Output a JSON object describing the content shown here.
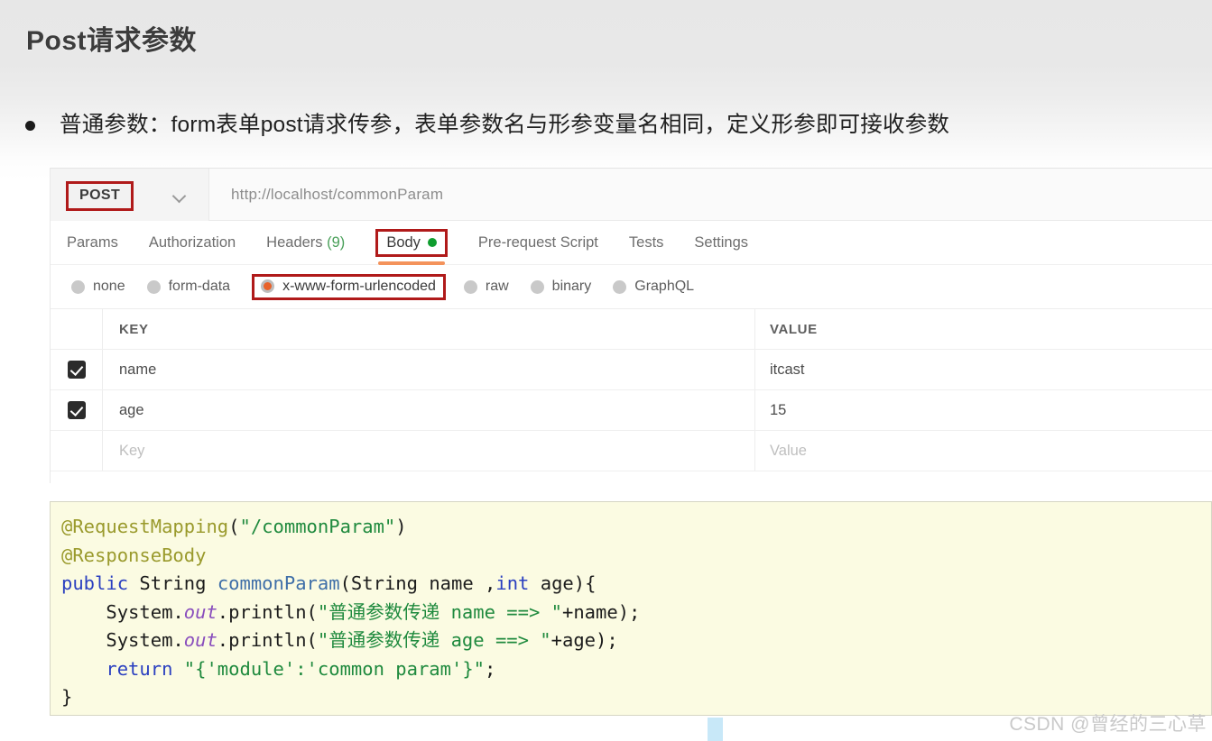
{
  "slide": {
    "title": "Post请求参数",
    "bullet": "普通参数：form表单post请求传参，表单参数名与形参变量名相同，定义形参即可接收参数"
  },
  "postman": {
    "method": "POST",
    "method_caret": "chevron-down-icon",
    "url": "http://localhost/commonParam",
    "tabs": [
      {
        "label": "Params",
        "active": false
      },
      {
        "label": "Authorization",
        "active": false
      },
      {
        "label": "Headers",
        "count": "(9)",
        "active": false
      },
      {
        "label": "Body",
        "active": true,
        "dot": true
      },
      {
        "label": "Pre-request Script",
        "active": false
      },
      {
        "label": "Tests",
        "active": false
      },
      {
        "label": "Settings",
        "active": false
      }
    ],
    "body_types": [
      {
        "label": "none",
        "selected": false
      },
      {
        "label": "form-data",
        "selected": false
      },
      {
        "label": "x-www-form-urlencoded",
        "selected": true
      },
      {
        "label": "raw",
        "selected": false
      },
      {
        "label": "binary",
        "selected": false
      },
      {
        "label": "GraphQL",
        "selected": false
      }
    ],
    "table": {
      "columns": [
        "KEY",
        "VALUE"
      ],
      "rows": [
        {
          "checked": true,
          "key": "name",
          "value": "itcast"
        },
        {
          "checked": true,
          "key": "age",
          "value": "15"
        }
      ],
      "placeholder_row": {
        "key": "Key",
        "value": "Value"
      }
    }
  },
  "code": {
    "lines": [
      [
        {
          "t": "@RequestMapping",
          "c": "ann"
        },
        {
          "t": "(",
          "c": "pl"
        },
        {
          "t": "\"/commonParam\"",
          "c": "str"
        },
        {
          "t": ")",
          "c": "pl"
        }
      ],
      [
        {
          "t": "@ResponseBody",
          "c": "ann"
        }
      ],
      [
        {
          "t": "public",
          "c": "kw"
        },
        {
          "t": " String ",
          "c": "pl"
        },
        {
          "t": "commonParam",
          "c": "fn"
        },
        {
          "t": "(String name ,",
          "c": "pl"
        },
        {
          "t": "int",
          "c": "kw"
        },
        {
          "t": " age){",
          "c": "pl"
        }
      ],
      [
        {
          "t": "    System.",
          "c": "pl"
        },
        {
          "t": "out",
          "c": "fld"
        },
        {
          "t": ".println(",
          "c": "pl"
        },
        {
          "t": "\"普通参数传递 name ==> \"",
          "c": "str"
        },
        {
          "t": "+name);",
          "c": "pl"
        }
      ],
      [
        {
          "t": "    System.",
          "c": "pl"
        },
        {
          "t": "out",
          "c": "fld"
        },
        {
          "t": ".println(",
          "c": "pl"
        },
        {
          "t": "\"普通参数传递 age ==> \"",
          "c": "str"
        },
        {
          "t": "+age);",
          "c": "pl"
        }
      ],
      [
        {
          "t": "    ",
          "c": "pl"
        },
        {
          "t": "return",
          "c": "kw"
        },
        {
          "t": " ",
          "c": "pl"
        },
        {
          "t": "\"{'module':'common param'}\"",
          "c": "str"
        },
        {
          "t": ";",
          "c": "pl"
        }
      ],
      [
        {
          "t": "}",
          "c": "pl"
        }
      ]
    ]
  },
  "watermark": "CSDN @曾经的三心草",
  "colors": {
    "highlight_box": "#b01a1a",
    "tab_underline": "#f4935b",
    "green_dot": "#0f9d2f",
    "radio_selected": "#e8622a",
    "code_bg": "#fbfbe2",
    "caret": "#c8e8f8"
  }
}
